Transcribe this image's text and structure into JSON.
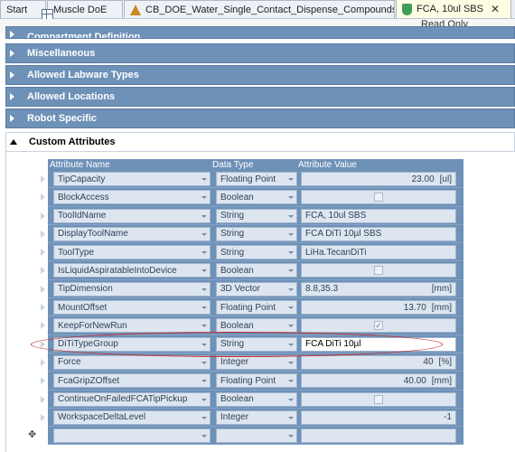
{
  "tabs": [
    {
      "label": "Start",
      "icon": "none"
    },
    {
      "label": "Muscle DoE",
      "icon": "grid-icon"
    },
    {
      "label": "CB_DOE_Water_Single_Contact_Dispense_Compounds_Addition",
      "icon": "home-icon"
    },
    {
      "label": "FCA, 10ul SBS",
      "icon": "flask-icon",
      "close": "✕"
    }
  ],
  "status": {
    "read_only": "Read Only"
  },
  "sections": {
    "compartment": "Compartment Definition",
    "misc": "Miscellaneous",
    "labware": "Allowed Labware Types",
    "locations": "Allowed Locations",
    "robot": "Robot Specific",
    "custom": "Custom Attributes"
  },
  "grid": {
    "headers": {
      "name": "Attribute Name",
      "type": "Data Type",
      "value": "Attribute Value"
    },
    "rows": [
      {
        "name": "TipCapacity",
        "type": "Floating Point",
        "value": "23.00",
        "unit": "[ul]"
      },
      {
        "name": "BlockAccess",
        "type": "Boolean",
        "checkbox": true,
        "checked": false
      },
      {
        "name": "ToolIdName",
        "type": "String",
        "value": "FCA, 10ul SBS"
      },
      {
        "name": "DisplayToolName",
        "type": "String",
        "value": "FCA DiTi 10µl SBS"
      },
      {
        "name": "ToolType",
        "type": "String",
        "value": "LiHa.TecanDiTi"
      },
      {
        "name": "IsLiquidAspiratableIntoDevice",
        "type": "Boolean",
        "checkbox": true,
        "checked": false
      },
      {
        "name": "TipDimension",
        "type": "3D Vector",
        "value": "8.8,35.3",
        "unit": "[mm]"
      },
      {
        "name": "MountOffset",
        "type": "Floating Point",
        "value": "13.70",
        "unit": "[mm]"
      },
      {
        "name": "KeepForNewRun",
        "type": "Boolean",
        "checkbox": true,
        "checked": true
      },
      {
        "name": "DiTiTypeGroup",
        "type": "String",
        "value": "FCA DiTi 10µl",
        "editable": true
      },
      {
        "name": "Force",
        "type": "Integer",
        "value": "40",
        "unit": "[%]"
      },
      {
        "name": "FcaGripZOffset",
        "type": "Floating Point",
        "value": "40.00",
        "unit": "[mm]"
      },
      {
        "name": "ContinueOnFailedFCATipPickup",
        "type": "Boolean",
        "checkbox": true,
        "checked": false
      },
      {
        "name": "WorkspaceDeltaLevel",
        "type": "Integer",
        "value": "-1"
      }
    ],
    "new_row_icon": "✥"
  },
  "colors": {
    "header": "#6e91b8",
    "annotation": "#c42a2a",
    "active_tab": "#fffde3"
  }
}
